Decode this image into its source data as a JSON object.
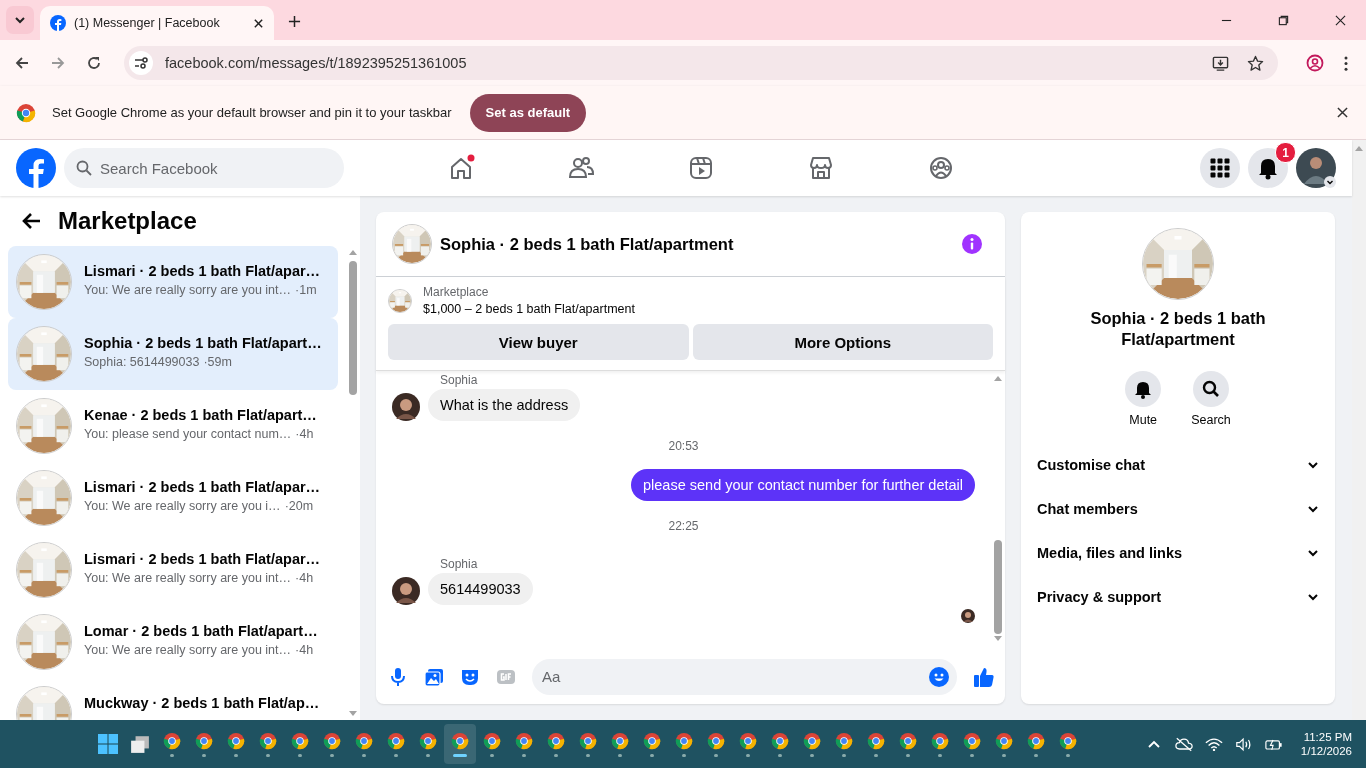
{
  "browser": {
    "tab_title": "(1) Messenger | Facebook",
    "url": "facebook.com/messages/t/1892395251361005",
    "infobar": {
      "message": "Set Google Chrome as your default browser and pin it to your taskbar",
      "button": "Set as default"
    }
  },
  "facebook_nav": {
    "search": {
      "placeholder": "Search Facebook"
    },
    "tabs": [
      {
        "kind": "home",
        "selected": false,
        "dot": true
      },
      {
        "kind": "friends",
        "selected": false
      },
      {
        "kind": "video",
        "selected": false
      },
      {
        "kind": "marketplace",
        "selected": false
      },
      {
        "kind": "groups",
        "selected": false
      }
    ],
    "notifications_badge": "1"
  },
  "sidebar": {
    "title": "Marketplace",
    "conversations": [
      {
        "name": "Lismari · 2 beds 1 bath Flat/apar…",
        "preview": "You: We are really sorry are you int…",
        "time": "·1m",
        "selected": true
      },
      {
        "name": "Sophia · 2 beds 1 bath Flat/apart…",
        "preview": "Sophia: 5614499033",
        "time": "·59m",
        "selected": true
      },
      {
        "name": "Kenae · 2 beds 1 bath Flat/apart…",
        "preview": "You: please send your contact num…",
        "time": "·4h",
        "selected": false
      },
      {
        "name": "Lismari · 2 beds 1 bath Flat/apar…",
        "preview": "You: We are really sorry are you i…",
        "time": "·20m",
        "selected": false
      },
      {
        "name": "Lismari · 2 beds 1 bath Flat/apar…",
        "preview": "You: We are really sorry are you int…",
        "time": "·4h",
        "selected": false
      },
      {
        "name": "Lomar · 2 beds 1 bath Flat/apart…",
        "preview": "You: We are really sorry are you int…",
        "time": "·4h",
        "selected": false
      },
      {
        "name": "Muckway · 2 beds 1 bath Flat/ap…",
        "selected": false
      }
    ]
  },
  "chat": {
    "title": "Sophia · 2 beds 1 bath Flat/apartment",
    "listing": {
      "label": "Marketplace",
      "summary": "$1,000 – 2 beds 1 bath Flat/apartment",
      "buttons": [
        "View buyer",
        "More Options"
      ]
    },
    "messages": [
      {
        "kind": "incoming",
        "sender": "Sophia",
        "text": "What is the address"
      },
      {
        "kind": "timestamp",
        "text": "20:53"
      },
      {
        "kind": "outgoing",
        "text": "please send your contact number for further detail"
      },
      {
        "kind": "timestamp",
        "text": "22:25"
      },
      {
        "kind": "incoming",
        "sender": "Sophia",
        "text": "5614499033"
      }
    ],
    "seen": true,
    "composer": {
      "placeholder": "Aa"
    }
  },
  "details": {
    "title": "Sophia · 2 beds 1 bath Flat/apartment",
    "actions": [
      {
        "kind": "mute",
        "label": "Mute"
      },
      {
        "kind": "search",
        "label": "Search"
      }
    ],
    "sections": [
      {
        "label": "Customise chat",
        "expanded": false
      },
      {
        "label": "Chat members",
        "expanded": false
      },
      {
        "label": "Media, files and links",
        "expanded": false
      },
      {
        "label": "Privacy & support",
        "expanded": false
      }
    ]
  },
  "taskbar": {
    "apps": [
      {
        "selected": false
      },
      {
        "selected": false
      },
      {
        "selected": false
      },
      {
        "selected": false
      },
      {
        "selected": false
      },
      {
        "selected": false
      },
      {
        "selected": false
      },
      {
        "selected": false
      },
      {
        "selected": false
      },
      {
        "selected": true
      },
      {
        "selected": false
      },
      {
        "selected": false
      },
      {
        "selected": false
      },
      {
        "selected": false
      },
      {
        "selected": false
      },
      {
        "selected": false
      },
      {
        "selected": false
      },
      {
        "selected": false
      },
      {
        "selected": false
      },
      {
        "selected": false
      },
      {
        "selected": false
      },
      {
        "selected": false
      },
      {
        "selected": false
      },
      {
        "selected": false
      },
      {
        "selected": false
      },
      {
        "selected": false
      },
      {
        "selected": false
      },
      {
        "selected": false
      },
      {
        "selected": false
      }
    ],
    "time": "11:25 PM",
    "date": "1/12/2026"
  }
}
